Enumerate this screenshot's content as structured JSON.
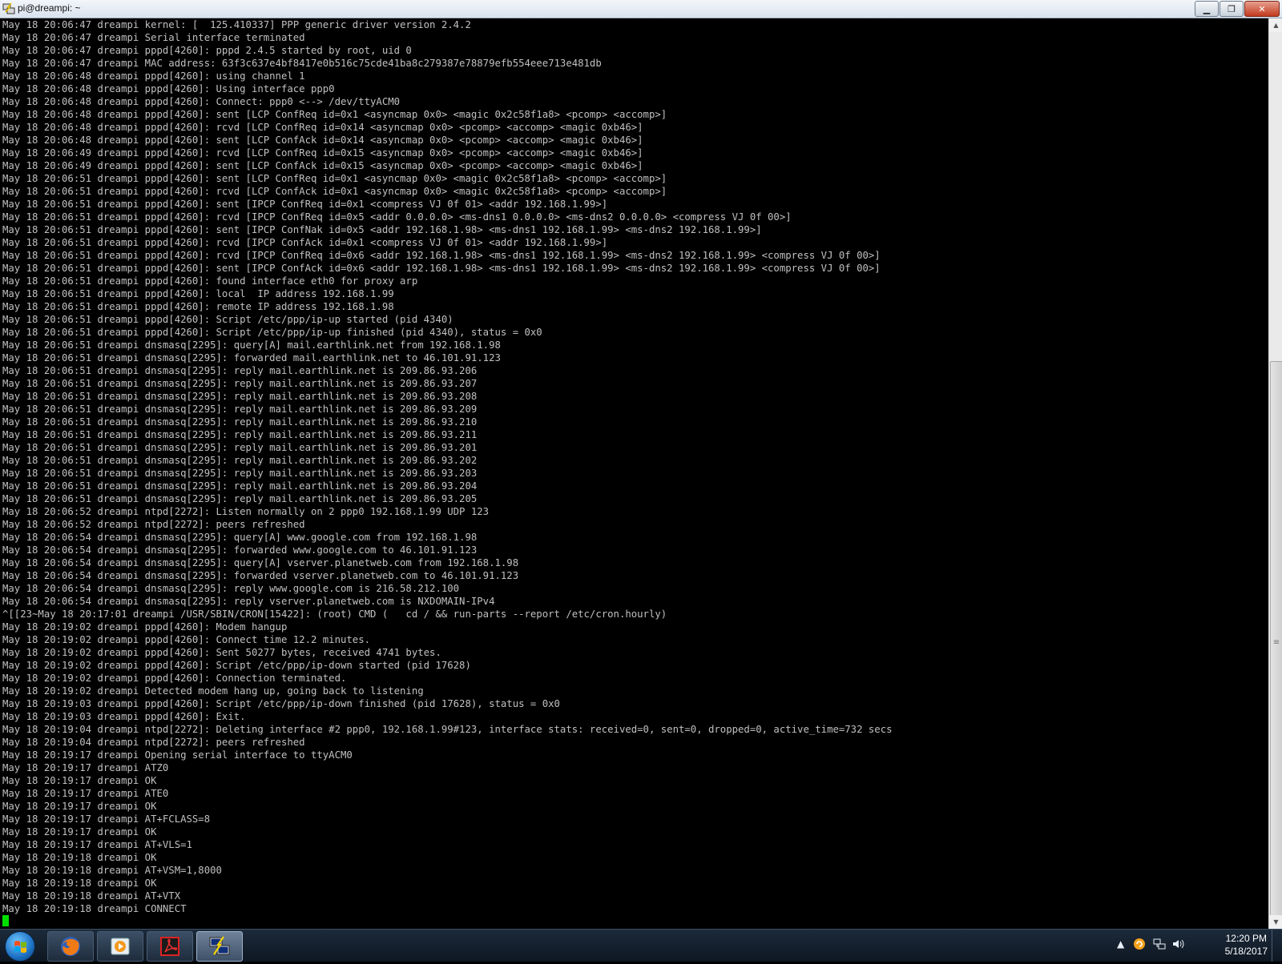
{
  "window": {
    "title": "pi@dreampi: ~"
  },
  "terminal": {
    "lines": [
      "May 18 20:06:47 dreampi kernel: [  125.410337] PPP generic driver version 2.4.2",
      "May 18 20:06:47 dreampi Serial interface terminated",
      "May 18 20:06:47 dreampi pppd[4260]: pppd 2.4.5 started by root, uid 0",
      "May 18 20:06:47 dreampi MAC address: 63f3c637e4bf8417e0b516c75cde41ba8c279387e78879efb554eee713e481db",
      "May 18 20:06:48 dreampi pppd[4260]: using channel 1",
      "May 18 20:06:48 dreampi pppd[4260]: Using interface ppp0",
      "May 18 20:06:48 dreampi pppd[4260]: Connect: ppp0 <--> /dev/ttyACM0",
      "May 18 20:06:48 dreampi pppd[4260]: sent [LCP ConfReq id=0x1 <asyncmap 0x0> <magic 0x2c58f1a8> <pcomp> <accomp>]",
      "May 18 20:06:48 dreampi pppd[4260]: rcvd [LCP ConfReq id=0x14 <asyncmap 0x0> <pcomp> <accomp> <magic 0xb46>]",
      "May 18 20:06:48 dreampi pppd[4260]: sent [LCP ConfAck id=0x14 <asyncmap 0x0> <pcomp> <accomp> <magic 0xb46>]",
      "May 18 20:06:49 dreampi pppd[4260]: rcvd [LCP ConfReq id=0x15 <asyncmap 0x0> <pcomp> <accomp> <magic 0xb46>]",
      "May 18 20:06:49 dreampi pppd[4260]: sent [LCP ConfAck id=0x15 <asyncmap 0x0> <pcomp> <accomp> <magic 0xb46>]",
      "May 18 20:06:51 dreampi pppd[4260]: sent [LCP ConfReq id=0x1 <asyncmap 0x0> <magic 0x2c58f1a8> <pcomp> <accomp>]",
      "May 18 20:06:51 dreampi pppd[4260]: rcvd [LCP ConfAck id=0x1 <asyncmap 0x0> <magic 0x2c58f1a8> <pcomp> <accomp>]",
      "May 18 20:06:51 dreampi pppd[4260]: sent [IPCP ConfReq id=0x1 <compress VJ 0f 01> <addr 192.168.1.99>]",
      "May 18 20:06:51 dreampi pppd[4260]: rcvd [IPCP ConfReq id=0x5 <addr 0.0.0.0> <ms-dns1 0.0.0.0> <ms-dns2 0.0.0.0> <compress VJ 0f 00>]",
      "May 18 20:06:51 dreampi pppd[4260]: sent [IPCP ConfNak id=0x5 <addr 192.168.1.98> <ms-dns1 192.168.1.99> <ms-dns2 192.168.1.99>]",
      "May 18 20:06:51 dreampi pppd[4260]: rcvd [IPCP ConfAck id=0x1 <compress VJ 0f 01> <addr 192.168.1.99>]",
      "May 18 20:06:51 dreampi pppd[4260]: rcvd [IPCP ConfReq id=0x6 <addr 192.168.1.98> <ms-dns1 192.168.1.99> <ms-dns2 192.168.1.99> <compress VJ 0f 00>]",
      "May 18 20:06:51 dreampi pppd[4260]: sent [IPCP ConfAck id=0x6 <addr 192.168.1.98> <ms-dns1 192.168.1.99> <ms-dns2 192.168.1.99> <compress VJ 0f 00>]",
      "May 18 20:06:51 dreampi pppd[4260]: found interface eth0 for proxy arp",
      "May 18 20:06:51 dreampi pppd[4260]: local  IP address 192.168.1.99",
      "May 18 20:06:51 dreampi pppd[4260]: remote IP address 192.168.1.98",
      "May 18 20:06:51 dreampi pppd[4260]: Script /etc/ppp/ip-up started (pid 4340)",
      "May 18 20:06:51 dreampi pppd[4260]: Script /etc/ppp/ip-up finished (pid 4340), status = 0x0",
      "May 18 20:06:51 dreampi dnsmasq[2295]: query[A] mail.earthlink.net from 192.168.1.98",
      "May 18 20:06:51 dreampi dnsmasq[2295]: forwarded mail.earthlink.net to 46.101.91.123",
      "May 18 20:06:51 dreampi dnsmasq[2295]: reply mail.earthlink.net is 209.86.93.206",
      "May 18 20:06:51 dreampi dnsmasq[2295]: reply mail.earthlink.net is 209.86.93.207",
      "May 18 20:06:51 dreampi dnsmasq[2295]: reply mail.earthlink.net is 209.86.93.208",
      "May 18 20:06:51 dreampi dnsmasq[2295]: reply mail.earthlink.net is 209.86.93.209",
      "May 18 20:06:51 dreampi dnsmasq[2295]: reply mail.earthlink.net is 209.86.93.210",
      "May 18 20:06:51 dreampi dnsmasq[2295]: reply mail.earthlink.net is 209.86.93.211",
      "May 18 20:06:51 dreampi dnsmasq[2295]: reply mail.earthlink.net is 209.86.93.201",
      "May 18 20:06:51 dreampi dnsmasq[2295]: reply mail.earthlink.net is 209.86.93.202",
      "May 18 20:06:51 dreampi dnsmasq[2295]: reply mail.earthlink.net is 209.86.93.203",
      "May 18 20:06:51 dreampi dnsmasq[2295]: reply mail.earthlink.net is 209.86.93.204",
      "May 18 20:06:51 dreampi dnsmasq[2295]: reply mail.earthlink.net is 209.86.93.205",
      "May 18 20:06:52 dreampi ntpd[2272]: Listen normally on 2 ppp0 192.168.1.99 UDP 123",
      "May 18 20:06:52 dreampi ntpd[2272]: peers refreshed",
      "May 18 20:06:54 dreampi dnsmasq[2295]: query[A] www.google.com from 192.168.1.98",
      "May 18 20:06:54 dreampi dnsmasq[2295]: forwarded www.google.com to 46.101.91.123",
      "May 18 20:06:54 dreampi dnsmasq[2295]: query[A] vserver.planetweb.com from 192.168.1.98",
      "May 18 20:06:54 dreampi dnsmasq[2295]: forwarded vserver.planetweb.com to 46.101.91.123",
      "May 18 20:06:54 dreampi dnsmasq[2295]: reply www.google.com is 216.58.212.100",
      "May 18 20:06:54 dreampi dnsmasq[2295]: reply vserver.planetweb.com is NXDOMAIN-IPv4",
      "^[[23~May 18 20:17:01 dreampi /USR/SBIN/CRON[15422]: (root) CMD (   cd / && run-parts --report /etc/cron.hourly)",
      "May 18 20:19:02 dreampi pppd[4260]: Modem hangup",
      "May 18 20:19:02 dreampi pppd[4260]: Connect time 12.2 minutes.",
      "May 18 20:19:02 dreampi pppd[4260]: Sent 50277 bytes, received 4741 bytes.",
      "May 18 20:19:02 dreampi pppd[4260]: Script /etc/ppp/ip-down started (pid 17628)",
      "May 18 20:19:02 dreampi pppd[4260]: Connection terminated.",
      "May 18 20:19:02 dreampi Detected modem hang up, going back to listening",
      "May 18 20:19:03 dreampi pppd[4260]: Script /etc/ppp/ip-down finished (pid 17628), status = 0x0",
      "May 18 20:19:03 dreampi pppd[4260]: Exit.",
      "May 18 20:19:04 dreampi ntpd[2272]: Deleting interface #2 ppp0, 192.168.1.99#123, interface stats: received=0, sent=0, dropped=0, active_time=732 secs",
      "May 18 20:19:04 dreampi ntpd[2272]: peers refreshed",
      "May 18 20:19:17 dreampi Opening serial interface to ttyACM0",
      "May 18 20:19:17 dreampi ATZ0",
      "May 18 20:19:17 dreampi OK",
      "May 18 20:19:17 dreampi ATE0",
      "May 18 20:19:17 dreampi OK",
      "May 18 20:19:17 dreampi AT+FCLASS=8",
      "May 18 20:19:17 dreampi OK",
      "May 18 20:19:17 dreampi AT+VLS=1",
      "May 18 20:19:18 dreampi OK",
      "May 18 20:19:18 dreampi AT+VSM=1,8000",
      "May 18 20:19:18 dreampi OK",
      "May 18 20:19:18 dreampi AT+VTX",
      "May 18 20:19:18 dreampi CONNECT"
    ]
  },
  "taskbar": {
    "apps": [
      {
        "icon": "firefox-icon",
        "active": false
      },
      {
        "icon": "media-player-icon",
        "active": false
      },
      {
        "icon": "pdf-reader-icon",
        "active": false
      },
      {
        "icon": "putty-icon",
        "active": true
      }
    ],
    "clock_time": "12:20 PM",
    "clock_date": "5/18/2017"
  },
  "colors": {
    "terminal_bg": "#000000",
    "terminal_fg": "#c0c0c0",
    "cursor": "#00e000"
  }
}
